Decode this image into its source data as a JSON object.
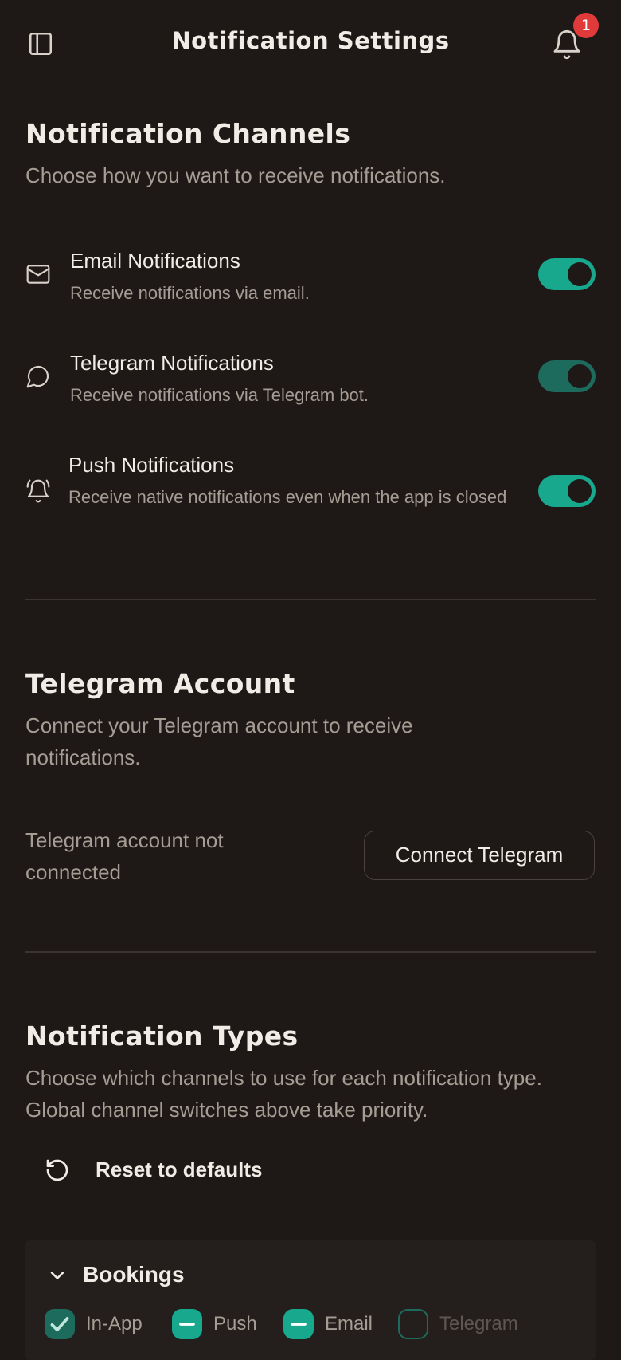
{
  "header": {
    "title": "Notification Settings",
    "notification_count": "1"
  },
  "channels_section": {
    "title": "Notification Channels",
    "description": "Choose how you want to receive notifications.",
    "items": [
      {
        "icon": "mail-icon",
        "title": "Email Notifications",
        "subtitle": "Receive notifications via email.",
        "enabled": true
      },
      {
        "icon": "chat-bubble-icon",
        "title": "Telegram Notifications",
        "subtitle": "Receive notifications via Telegram bot.",
        "enabled": true
      },
      {
        "icon": "bell-ring-icon",
        "title": "Push Notifications",
        "subtitle": "Receive native notifications even when the app is closed",
        "enabled": true
      }
    ]
  },
  "telegram_section": {
    "title": "Telegram Account",
    "description": "Connect your Telegram account to receive notifications.",
    "status": "Telegram account not connected",
    "connect_label": "Connect Telegram"
  },
  "types_section": {
    "title": "Notification Types",
    "description": "Choose which channels to use for each notification type. Global channel switches above take priority.",
    "reset_label": "Reset to defaults",
    "groups": [
      {
        "title": "Bookings",
        "channels": [
          {
            "label": "In-App",
            "state": "checked"
          },
          {
            "label": "Push",
            "state": "indeterminate"
          },
          {
            "label": "Email",
            "state": "indeterminate"
          },
          {
            "label": "Telegram",
            "state": "unchecked"
          }
        ]
      }
    ]
  },
  "colors": {
    "background": "#1e1917",
    "accent": "#17a88e",
    "accent_dim": "#1d6b5d",
    "badge": "#e03a3a",
    "muted_text": "#a59c94"
  }
}
